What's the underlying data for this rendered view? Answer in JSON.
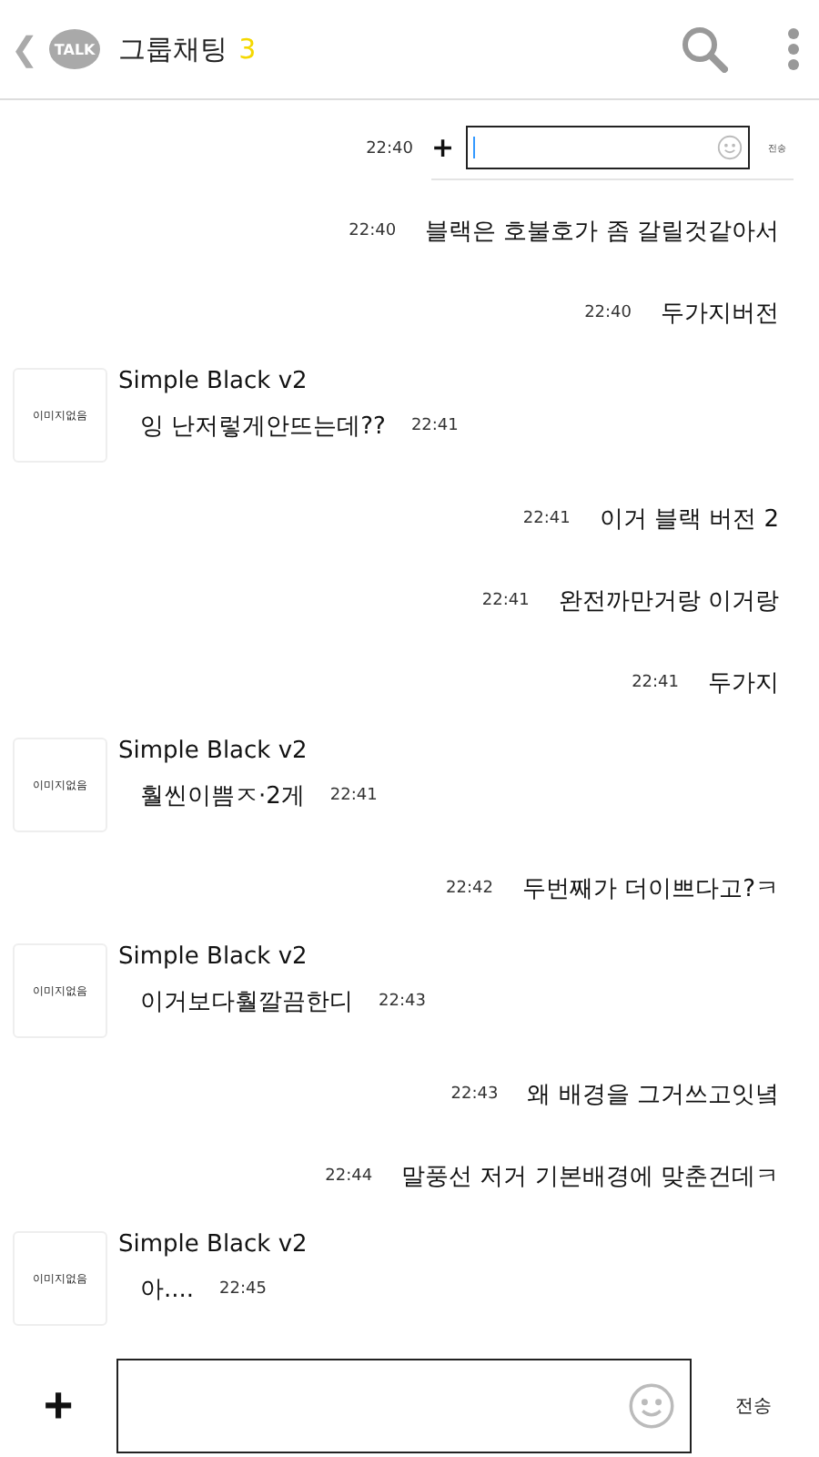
{
  "header": {
    "back": "❮",
    "logo": "TALK",
    "title": "그룹채팅",
    "member_count": "3"
  },
  "messages": [
    {
      "time": "22:40",
      "image": {
        "plus": "+",
        "send": "전송"
      }
    },
    {
      "kind": "mine",
      "time": "22:40",
      "text": "블랙은 호불호가 좀 갈릴것같아서"
    },
    {
      "kind": "mine",
      "time": "22:40",
      "text": "두가지버전"
    },
    {
      "kind": "theirs",
      "avatar": "이미지없음",
      "sender": "Simple Black v2",
      "time": "22:41",
      "text": "잉 난저렇게안뜨는데??"
    },
    {
      "kind": "mine",
      "time": "22:41",
      "text": "이거 블랙 버전 2"
    },
    {
      "kind": "mine",
      "time": "22:41",
      "text": "완전까만거랑 이거랑"
    },
    {
      "kind": "mine",
      "time": "22:41",
      "text": "두가지"
    },
    {
      "kind": "theirs",
      "avatar": "이미지없음",
      "sender": "Simple Black v2",
      "time": "22:41",
      "text": "훨씬이쁨ㅈ·2게"
    },
    {
      "kind": "mine",
      "time": "22:42",
      "text": "두번째가 더이쁘다고?ㅋ"
    },
    {
      "kind": "theirs",
      "avatar": "이미지없음",
      "sender": "Simple Black v2",
      "time": "22:43",
      "text": "이거보다훨깔끔한디"
    },
    {
      "kind": "mine",
      "time": "22:43",
      "text": "왜 배경을 그거쓰고잇녘"
    },
    {
      "kind": "mine",
      "time": "22:44",
      "text": "말풍선 저거 기본배경에 맞춘건데ㅋ"
    },
    {
      "kind": "theirs",
      "avatar": "이미지없음",
      "sender": "Simple Black v2",
      "time": "22:45",
      "text": "아...."
    }
  ],
  "composer": {
    "plus": "+",
    "send": "전송"
  }
}
